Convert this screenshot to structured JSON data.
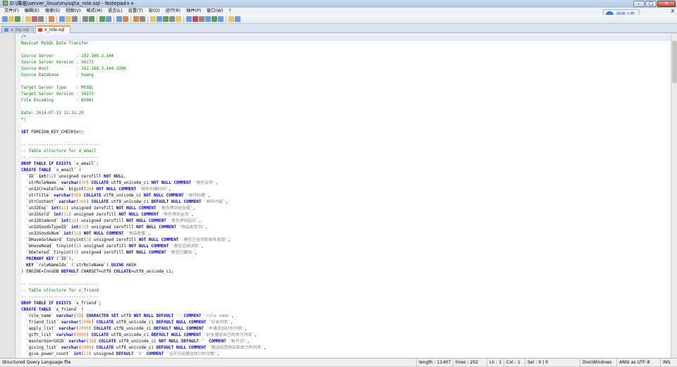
{
  "window": {
    "title": "D:\\降临\\server_linux\\mysql\\x_role.sql - Notepad++",
    "controls": [
      "–",
      "□",
      "✕"
    ]
  },
  "menu": [
    "文件(F)",
    "编辑(E)",
    "搜索(S)",
    "视图(V)",
    "格式(M)",
    "语言(L)",
    "设置(T)",
    "宏(O)",
    "运行(R)",
    "插件(P)",
    "窗口(W)",
    "?"
  ],
  "menu_close": "X",
  "cloud_button": "拖拽上传",
  "tabs": [
    {
      "label": "x_log.sql",
      "active": false
    },
    {
      "label": "x_role.sql",
      "active": true
    }
  ],
  "code_lines": [
    [
      [
        "c-com",
        "/*"
      ]
    ],
    [
      [
        "c-com",
        "Navicat MySQL Data Transfer"
      ]
    ],
    [
      [
        "c-com",
        ""
      ]
    ],
    [
      [
        "c-com",
        "Source Server         : 192.168.3.144"
      ]
    ],
    [
      [
        "c-com",
        "Source Server Version : 50173"
      ]
    ],
    [
      [
        "c-com",
        "Source Host           : 192.168.3.144:3306"
      ]
    ],
    [
      [
        "c-com",
        "Source Database       : huang"
      ]
    ],
    [
      [
        "c-com",
        ""
      ]
    ],
    [
      [
        "c-com",
        "Target Server Type    : MYSQL"
      ]
    ],
    [
      [
        "c-com",
        "Target Server Version : 50173"
      ]
    ],
    [
      [
        "c-com",
        "File Encoding         : 65001"
      ]
    ],
    [
      [
        "c-com",
        ""
      ]
    ],
    [
      [
        "c-com",
        "Date: 2014-07-15 11:31:29"
      ]
    ],
    [
      [
        "c-com",
        "*/"
      ]
    ],
    [
      [
        "c-txt",
        ""
      ]
    ],
    [
      [
        "c-kw",
        "SET"
      ],
      [
        "c-txt",
        " FOREIGN_KEY_CHECKS="
      ],
      [
        "c-num",
        "0"
      ],
      [
        "c-txt",
        ";"
      ]
    ],
    [
      [
        "c-txt",
        ""
      ]
    ],
    [
      [
        "c-com",
        "-- ----------------------------"
      ]
    ],
    [
      [
        "c-com",
        "-- Table structure for x_email"
      ]
    ],
    [
      [
        "c-com",
        "-- ----------------------------"
      ]
    ],
    [
      [
        "c-kw",
        "DROP TABLE IF EXISTS"
      ],
      [
        "c-txt",
        " `x_email`;"
      ]
    ],
    [
      [
        "c-kw",
        "CREATE TABLE"
      ],
      [
        "c-txt",
        " `x_email` ("
      ]
    ],
    [
      [
        "c-txt",
        "  `ID` "
      ],
      [
        "c-kw",
        "int"
      ],
      [
        "c-txt",
        "("
      ],
      [
        "c-num",
        "11"
      ],
      [
        "c-txt",
        ") unsigned zerofill "
      ],
      [
        "c-kw",
        "NOT NULL"
      ],
      [
        "c-txt",
        ","
      ]
    ],
    [
      [
        "c-txt",
        "  `strRoleName` "
      ],
      [
        "c-kw",
        "varchar"
      ],
      [
        "c-txt",
        "("
      ],
      [
        "c-num",
        "50"
      ],
      [
        "c-txt",
        ") "
      ],
      [
        "c-kw",
        "COLLATE"
      ],
      [
        "c-txt",
        " utf8_unicode_ci "
      ],
      [
        "c-kw",
        "NOT NULL COMMENT"
      ],
      [
        "c-str",
        " '角色名称'"
      ],
      [
        "c-txt",
        ","
      ]
    ],
    [
      [
        "c-txt",
        "  `un32CreateTime` bigint("
      ],
      [
        "c-num",
        "20"
      ],
      [
        "c-txt",
        ") "
      ],
      [
        "c-kw",
        "NOT NULL COMMENT"
      ],
      [
        "c-str",
        " '邮件创建时间'"
      ],
      [
        "c-txt",
        ","
      ]
    ],
    [
      [
        "c-txt",
        "  `strTitle` "
      ],
      [
        "c-kw",
        "varchar"
      ],
      [
        "c-txt",
        "("
      ],
      [
        "c-num",
        "50"
      ],
      [
        "c-txt",
        ") "
      ],
      [
        "c-kw",
        "COLLATE"
      ],
      [
        "c-txt",
        " utf8_unicode_ci "
      ],
      [
        "c-kw",
        "NOT NULL COMMENT"
      ],
      [
        "c-str",
        " '邮件标题'"
      ],
      [
        "c-txt",
        ","
      ]
    ],
    [
      [
        "c-txt",
        "  `strContent` "
      ],
      [
        "c-kw",
        "varchar"
      ],
      [
        "c-txt",
        "("
      ],
      [
        "c-num",
        "300"
      ],
      [
        "c-txt",
        ") "
      ],
      [
        "c-kw",
        "COLLATE"
      ],
      [
        "c-txt",
        " utf8_unicode_ci "
      ],
      [
        "c-kw",
        "DEFAULT NULL COMMENT"
      ],
      [
        "c-str",
        " '邮件内容'"
      ],
      [
        "c-txt",
        ","
      ]
    ],
    [
      [
        "c-txt",
        "  `un32Exp` "
      ],
      [
        "c-kw",
        "int"
      ],
      [
        "c-txt",
        "("
      ],
      [
        "c-num",
        "11"
      ],
      [
        "c-txt",
        ") unsigned zerofill "
      ],
      [
        "c-kw",
        "NOT NULL COMMENT"
      ],
      [
        "c-str",
        " '角色得到经验值'"
      ],
      [
        "c-txt",
        ","
      ]
    ],
    [
      [
        "c-txt",
        "  `un32Gold` "
      ],
      [
        "c-kw",
        "int"
      ],
      [
        "c-txt",
        "("
      ],
      [
        "c-num",
        "11"
      ],
      [
        "c-txt",
        ") unsigned zerofill "
      ],
      [
        "c-kw",
        "NOT NULL COMMENT"
      ],
      [
        "c-str",
        " '角色得到金币'"
      ],
      [
        "c-txt",
        ","
      ]
    ],
    [
      [
        "c-txt",
        "  `un32Diamond` "
      ],
      [
        "c-kw",
        "int"
      ],
      [
        "c-txt",
        "("
      ],
      [
        "c-num",
        "11"
      ],
      [
        "c-txt",
        ") unsigned zerofill "
      ],
      [
        "c-kw",
        "NOT NULL COMMENT"
      ],
      [
        "c-str",
        " '角色得到钻石'"
      ],
      [
        "c-txt",
        ","
      ]
    ],
    [
      [
        "c-txt",
        "  `un32GoodsTypeID` "
      ],
      [
        "c-kw",
        "int"
      ],
      [
        "c-txt",
        "("
      ],
      [
        "c-num",
        "11"
      ],
      [
        "c-txt",
        ") unsigned zerofill "
      ],
      [
        "c-kw",
        "NOT NULL COMMENT"
      ],
      [
        "c-str",
        " '物品类型ID'"
      ],
      [
        "c-txt",
        ","
      ]
    ],
    [
      [
        "c-txt",
        "  `un32GoodsNum` "
      ],
      [
        "c-kw",
        "int"
      ],
      [
        "c-txt",
        "("
      ],
      [
        "c-num",
        "11"
      ],
      [
        "c-txt",
        ") "
      ],
      [
        "c-kw",
        "NOT NULL COMMENT"
      ],
      [
        "c-str",
        " '物品数量'"
      ],
      [
        "c-txt",
        ","
      ]
    ],
    [
      [
        "c-txt",
        "  `bHaveGotAward` tinyint("
      ],
      [
        "c-num",
        "3"
      ],
      [
        "c-txt",
        ") unsigned zerofill "
      ],
      [
        "c-kw",
        "NOT NULL COMMENT"
      ],
      [
        "c-str",
        " '是否已经领取邮件奖励'"
      ],
      [
        "c-txt",
        ","
      ]
    ],
    [
      [
        "c-txt",
        "  `bHaveRead` tinyint("
      ],
      [
        "c-num",
        "3"
      ],
      [
        "c-txt",
        ") unsigned zerofill "
      ],
      [
        "c-kw",
        "NOT NULL COMMENT"
      ],
      [
        "c-str",
        " '是否已经读取'"
      ],
      [
        "c-txt",
        ","
      ]
    ],
    [
      [
        "c-txt",
        "  `bDeleted` tinyint("
      ],
      [
        "c-num",
        "3"
      ],
      [
        "c-txt",
        ") unsigned zerofill "
      ],
      [
        "c-kw",
        "NOT NULL COMMENT"
      ],
      [
        "c-str",
        " '是否已删除'"
      ],
      [
        "c-txt",
        ","
      ]
    ],
    [
      [
        "c-txt",
        "  "
      ],
      [
        "c-kw",
        "PRIMARY KEY"
      ],
      [
        "c-txt",
        " (`ID`),"
      ]
    ],
    [
      [
        "c-txt",
        "  "
      ],
      [
        "c-kw",
        "KEY"
      ],
      [
        "c-txt",
        " `roleNameIdx` (`strRoleName`) "
      ],
      [
        "c-kw",
        "USING"
      ],
      [
        "c-txt",
        " HASH"
      ]
    ],
    [
      [
        "c-txt",
        ") ENGINE=InnoDB "
      ],
      [
        "c-kw",
        "DEFAULT"
      ],
      [
        "c-txt",
        " CHARSET=utf8 "
      ],
      [
        "c-kw",
        "COLLATE"
      ],
      [
        "c-txt",
        "=utf8_unicode_ci;"
      ]
    ],
    [
      [
        "c-txt",
        ""
      ]
    ],
    [
      [
        "c-com",
        "-- ----------------------------"
      ]
    ],
    [
      [
        "c-com",
        "-- Table structure for x_friend"
      ]
    ],
    [
      [
        "c-com",
        "-- ----------------------------"
      ]
    ],
    [
      [
        "c-kw",
        "DROP TABLE IF EXISTS"
      ],
      [
        "c-txt",
        " `x_friend`;"
      ]
    ],
    [
      [
        "c-kw",
        "CREATE TABLE"
      ],
      [
        "c-txt",
        " `x_friend` ("
      ]
    ],
    [
      [
        "c-txt",
        "  `role_name` "
      ],
      [
        "c-kw",
        "varchar"
      ],
      [
        "c-txt",
        "("
      ],
      [
        "c-num",
        "20"
      ],
      [
        "c-txt",
        ") "
      ],
      [
        "c-kw",
        "CHARACTER SET"
      ],
      [
        "c-txt",
        " utf8 "
      ],
      [
        "c-kw",
        "NOT NULL DEFAULT"
      ],
      [
        "c-str",
        " ''"
      ],
      [
        "c-kw",
        " COMMENT"
      ],
      [
        "c-str",
        " 'role name'"
      ],
      [
        "c-txt",
        ","
      ]
    ],
    [
      [
        "c-txt",
        "  `friend_list` "
      ],
      [
        "c-kw",
        "varchar"
      ],
      [
        "c-txt",
        "("
      ],
      [
        "c-num",
        "2000"
      ],
      [
        "c-txt",
        ") "
      ],
      [
        "c-kw",
        "COLLATE"
      ],
      [
        "c-txt",
        " utf8_unicode_ci "
      ],
      [
        "c-kw",
        "DEFAULT NULL COMMENT"
      ],
      [
        "c-str",
        " '好友列表'"
      ],
      [
        "c-txt",
        ","
      ]
    ],
    [
      [
        "c-txt",
        "  `apply_list` "
      ],
      [
        "c-kw",
        "varchar"
      ],
      [
        "c-txt",
        "("
      ],
      [
        "c-num",
        "2000"
      ],
      [
        "c-txt",
        ") "
      ],
      [
        "c-kw",
        "COLLATE"
      ],
      [
        "c-txt",
        " utf8_unicode_ci "
      ],
      [
        "c-kw",
        "DEFAULT NULL COMMENT"
      ],
      [
        "c-str",
        " '申请添加好友列表'"
      ],
      [
        "c-txt",
        ","
      ]
    ],
    [
      [
        "c-txt",
        "  `gift_list` "
      ],
      [
        "c-kw",
        "varchar"
      ],
      [
        "c-txt",
        "("
      ],
      [
        "c-num",
        "2000"
      ],
      [
        "c-txt",
        ") "
      ],
      [
        "c-kw",
        "COLLATE"
      ],
      [
        "c-txt",
        " utf8_unicode_ci "
      ],
      [
        "c-kw",
        "DEFAULT NULL COMMENT"
      ],
      [
        "c-str",
        " '好友赠送自己的体力列表'"
      ],
      [
        "c-txt",
        ","
      ]
    ],
    [
      [
        "c-txt",
        "  `masterUserGUID` "
      ],
      [
        "c-kw",
        "varchar"
      ],
      [
        "c-txt",
        "("
      ],
      [
        "c-num",
        "36"
      ],
      [
        "c-txt",
        ") "
      ],
      [
        "c-kw",
        "COLLATE"
      ],
      [
        "c-txt",
        " utf8_unicode_ci "
      ],
      [
        "c-kw",
        "NOT NULL DEFAULT"
      ],
      [
        "c-str",
        " ''"
      ],
      [
        "c-kw",
        " COMMENT"
      ],
      [
        "c-str",
        " '帐号ID'"
      ],
      [
        "c-txt",
        ","
      ]
    ],
    [
      [
        "c-txt",
        "  `giving_list` "
      ],
      [
        "c-kw",
        "varchar"
      ],
      [
        "c-txt",
        "("
      ],
      [
        "c-num",
        "2000"
      ],
      [
        "c-txt",
        ") "
      ],
      [
        "c-kw",
        "COLLATE"
      ],
      [
        "c-txt",
        " utf8_unicode_ci "
      ],
      [
        "c-kw",
        "DEFAULT NULL COMMENT"
      ],
      [
        "c-str",
        " '赠送给其他玩家体力的列表'"
      ],
      [
        "c-txt",
        ","
      ]
    ],
    [
      [
        "c-txt",
        "  `give_power_count` "
      ],
      [
        "c-kw",
        "int"
      ],
      [
        "c-txt",
        "("
      ],
      [
        "c-num",
        "11"
      ],
      [
        "c-txt",
        ") unsigned "
      ],
      [
        "c-kw",
        "DEFAULT"
      ],
      [
        "c-str",
        " '0'"
      ],
      [
        "c-kw",
        " COMMENT"
      ],
      [
        "c-str",
        " '当天已经赠送体力的次数'"
      ],
      [
        "c-txt",
        ","
      ]
    ]
  ],
  "fold_lines": [
    1,
    22,
    43
  ],
  "status": {
    "language": "Structured Query Language file",
    "length": "length : 11407",
    "lines": "lines : 202",
    "ln": "Ln : 1",
    "col": "Col : 1",
    "sel": "Sel : 0 | 0",
    "eol": "Dos\\Windows",
    "encoding": "ANSI as UTF-8",
    "mode": "INS"
  },
  "colors": {
    "comment": "#008000",
    "keyword": "#0000c8",
    "string": "#808080",
    "number": "#ff6400"
  }
}
